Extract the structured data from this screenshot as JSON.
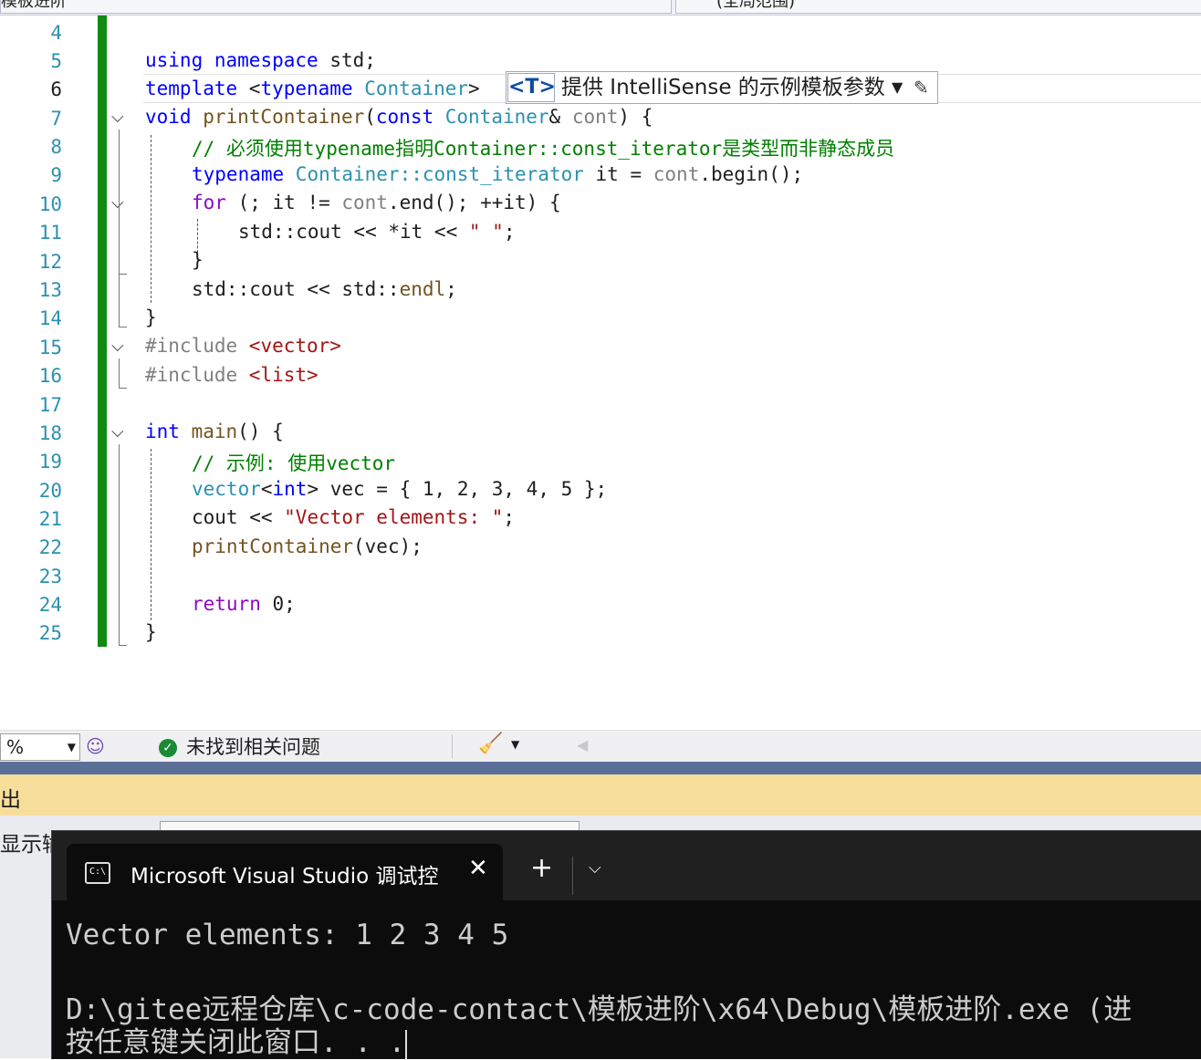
{
  "top_bar": {
    "left_combo": "模板进阶",
    "right_combo": "(全局范围)"
  },
  "editor": {
    "line_numbers": [
      "4",
      "5",
      "6",
      "7",
      "8",
      "9",
      "10",
      "11",
      "12",
      "13",
      "14",
      "15",
      "16",
      "17",
      "18",
      "19",
      "20",
      "21",
      "22",
      "23",
      "24",
      "25"
    ],
    "current_line": "6",
    "code": {
      "l5_a": "using",
      "l5_b": "namespace",
      "l5_c": " std;",
      "l6_a": "template",
      "l6_b": " <",
      "l6_c": "typename",
      "l6_d": " Container",
      "l6_e": ">",
      "l7_a": "void",
      "l7_b": " printContainer",
      "l7_c": "(",
      "l7_d": "const",
      "l7_e": " Container",
      "l7_f": "&",
      "l7_g": " cont",
      "l7_h": ")",
      "l7_i": " {",
      "l8": "// 必须使用typename指明Container::const_iterator是类型而非静态成员",
      "l9_a": "typename",
      "l9_b": " Container",
      "l9_c": "::const_iterator",
      "l9_d": " it",
      "l9_e": " = ",
      "l9_f": "cont",
      "l9_g": ".begin();",
      "l10_a": "for",
      "l10_b": " (; it != ",
      "l10_c": "cont",
      "l10_d": ".end(); ++it) {",
      "l11_a": "std::cout << *it << ",
      "l11_b": "\" \"",
      "l11_c": ";",
      "l12": "}",
      "l13_a": "std::cout << std::",
      "l13_b": "endl",
      "l13_c": ";",
      "l14": "}",
      "l15_a": "#include",
      "l15_b": " <vector>",
      "l16_a": "#include",
      "l16_b": " <list>",
      "l18_a": "int",
      "l18_b": " main",
      "l18_c": "() {",
      "l19": "// 示例: 使用vector",
      "l20_a": "vector",
      "l20_b": "<",
      "l20_c": "int",
      "l20_d": "> vec = { 1, 2, 3, 4, 5 };",
      "l21_a": "cout",
      "l21_b": " << ",
      "l21_c": "\"Vector elements: \"",
      "l21_d": ";",
      "l22_a": "printContainer",
      "l22_b": "(vec);",
      "l24_a": "return",
      "l24_b": " 0;",
      "l25": "}"
    },
    "intellisense_popup": {
      "tag": "<T>",
      "text": "提供 IntelliSense 的示例模板参数"
    }
  },
  "status_bar": {
    "zoom_value": "%",
    "issues_text": "未找到相关问题"
  },
  "output_panel": {
    "title": "出",
    "show_output_label": "显示输"
  },
  "console": {
    "tab_title": "Microsoft Visual Studio 调试控",
    "icon_text": "C:\\",
    "line1": "Vector elements: 1 2 3 4 5",
    "line2": "D:\\gitee远程仓库\\c-code-contact\\模板进阶\\x64\\Debug\\模板进阶.exe (进",
    "line3": "按任意键关闭此窗口. . ."
  },
  "colors": {
    "keyword": "#0000ff",
    "type": "#2b91af",
    "comment": "#008000",
    "string": "#a31515",
    "change_bar": "#108a10",
    "output_header": "#f7df9b",
    "console_bg": "#0c0c0c"
  }
}
